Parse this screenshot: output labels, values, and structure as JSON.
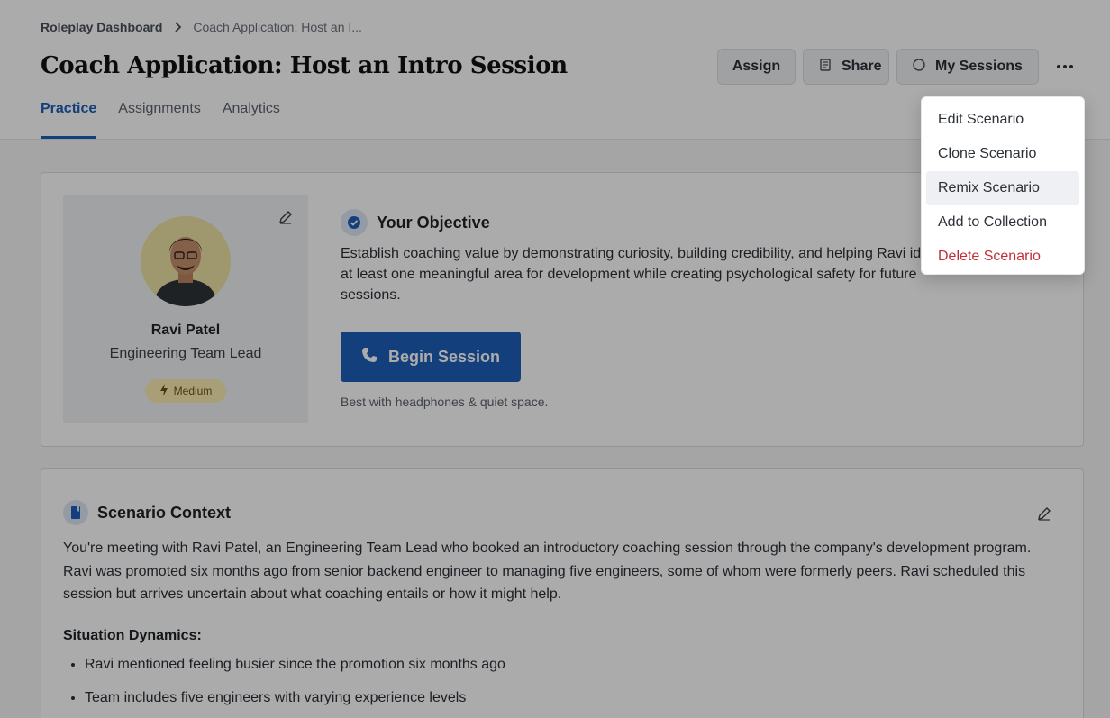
{
  "breadcrumb": {
    "root": "Roleplay Dashboard",
    "current": "Coach Application: Host an I..."
  },
  "header": {
    "title": "Coach Application: Host an Intro Session",
    "assign_label": "Assign",
    "share_label": "Share",
    "sessions_label": "My Sessions"
  },
  "tabs": [
    {
      "label": "Practice",
      "active": true
    },
    {
      "label": "Assignments",
      "active": false
    },
    {
      "label": "Analytics",
      "active": false
    }
  ],
  "persona": {
    "name": "Ravi Patel",
    "role": "Engineering Team Lead",
    "difficulty": "Medium"
  },
  "objective": {
    "title": "Your Objective",
    "text": "Establish coaching value by demonstrating curiosity, building credibility, and helping Ravi identify at least one meaningful area for development while creating psychological safety for future sessions.",
    "begin_label": "Begin Session",
    "hint": "Best with headphones & quiet space."
  },
  "context": {
    "title": "Scenario Context",
    "text": "You're meeting with Ravi Patel, an Engineering Team Lead who booked an introductory coaching session through the company's development program. Ravi was promoted six months ago from senior backend engineer to managing five engineers, some of whom were formerly peers. Ravi scheduled this session but arrives uncertain about what coaching entails or how it might help.",
    "dynamics_title": "Situation Dynamics:",
    "dynamics": [
      "Ravi mentioned feeling busier since the promotion six months ago",
      "Team includes five engineers with varying experience levels"
    ]
  },
  "menu": {
    "items": [
      {
        "label": "Edit Scenario"
      },
      {
        "label": "Clone Scenario"
      },
      {
        "label": "Remix Scenario",
        "highlighted": true
      },
      {
        "label": "Add to Collection"
      },
      {
        "label": "Delete Scenario",
        "danger": true
      }
    ]
  },
  "colors": {
    "accent": "#1d5fb9",
    "danger": "#c22f35",
    "badge_bg": "#fbeeb3"
  }
}
